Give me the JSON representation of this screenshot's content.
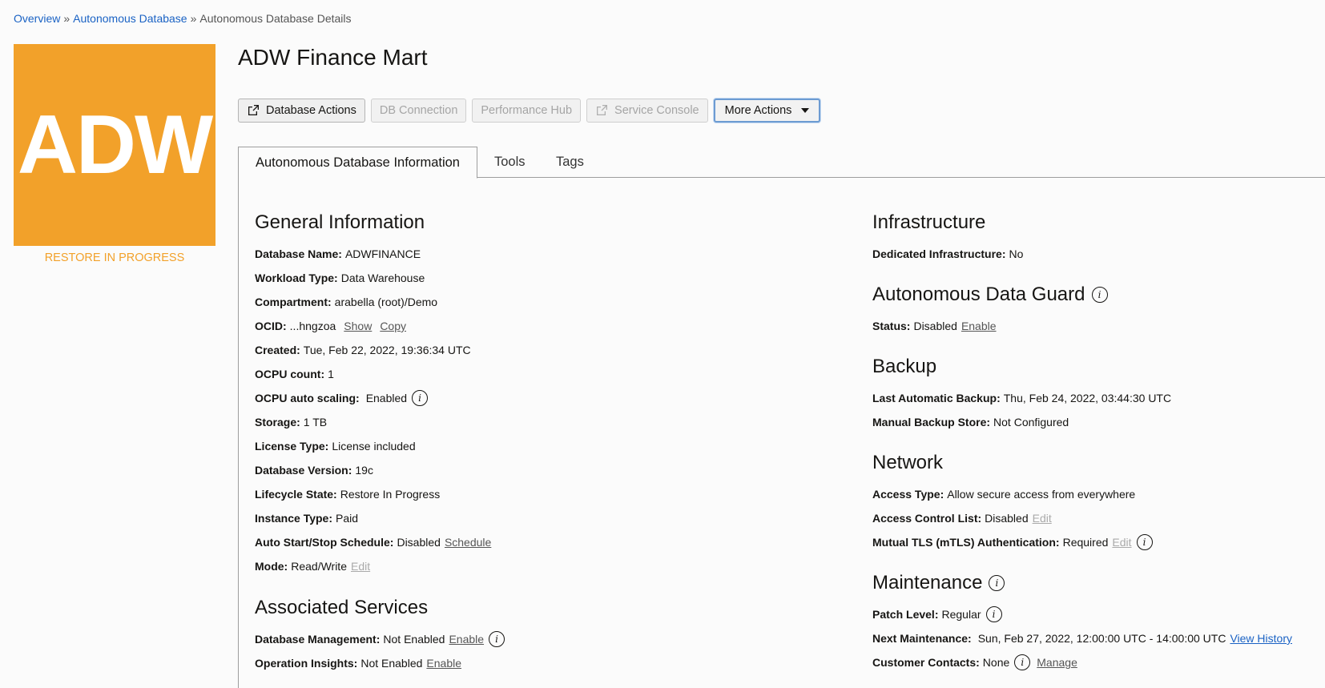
{
  "breadcrumb": {
    "items": [
      "Overview",
      "Autonomous Database"
    ],
    "current": "Autonomous Database Details",
    "separator": "»"
  },
  "logo": {
    "text": "ADW",
    "status": "RESTORE IN PROGRESS",
    "color": "#f2a12a"
  },
  "page": {
    "title": "ADW Finance Mart"
  },
  "actions": {
    "database_actions": "Database Actions",
    "db_connection": "DB Connection",
    "performance_hub": "Performance Hub",
    "service_console": "Service Console",
    "more_actions": "More Actions"
  },
  "tabs": [
    "Autonomous Database Information",
    "Tools",
    "Tags"
  ],
  "general": {
    "heading": "General Information",
    "db_name": {
      "label": "Database Name:",
      "value": "ADWFINANCE"
    },
    "workload": {
      "label": "Workload Type:",
      "value": "Data Warehouse"
    },
    "compartment": {
      "label": "Compartment:",
      "value": "arabella (root)/Demo"
    },
    "ocid": {
      "label": "OCID:",
      "value": "...hngzoa",
      "show": "Show",
      "copy": "Copy"
    },
    "created": {
      "label": "Created:",
      "value": "Tue, Feb 22, 2022, 19:36:34 UTC"
    },
    "ocpu": {
      "label": "OCPU count:",
      "value": "1"
    },
    "autoscale": {
      "label": "OCPU auto scaling:",
      "value": "Enabled"
    },
    "storage": {
      "label": "Storage:",
      "value": "1 TB"
    },
    "license": {
      "label": "License Type:",
      "value": "License included"
    },
    "version": {
      "label": "Database Version:",
      "value": "19c"
    },
    "lifecycle": {
      "label": "Lifecycle State:",
      "value": "Restore In Progress"
    },
    "instance": {
      "label": "Instance Type:",
      "value": "Paid"
    },
    "schedule": {
      "label": "Auto Start/Stop Schedule:",
      "value": "Disabled",
      "link": "Schedule"
    },
    "mode": {
      "label": "Mode:",
      "value": "Read/Write",
      "link": "Edit"
    }
  },
  "associated": {
    "heading": "Associated Services",
    "dbmgmt": {
      "label": "Database Management:",
      "value": "Not Enabled",
      "link": "Enable"
    },
    "opsi": {
      "label": "Operation Insights:",
      "value": "Not Enabled",
      "link": "Enable"
    }
  },
  "infra": {
    "heading": "Infrastructure",
    "dedicated": {
      "label": "Dedicated Infrastructure:",
      "value": "No"
    }
  },
  "dataguard": {
    "heading": "Autonomous Data Guard",
    "status": {
      "label": "Status:",
      "value": "Disabled",
      "link": "Enable"
    }
  },
  "backup": {
    "heading": "Backup",
    "last": {
      "label": "Last Automatic Backup:",
      "value": "Thu, Feb 24, 2022, 03:44:30 UTC"
    },
    "store": {
      "label": "Manual Backup Store:",
      "value": "Not Configured"
    }
  },
  "network": {
    "heading": "Network",
    "access": {
      "label": "Access Type:",
      "value": "Allow secure access from everywhere"
    },
    "acl": {
      "label": "Access Control List:",
      "value": "Disabled",
      "link": "Edit"
    },
    "mtls": {
      "label": "Mutual TLS (mTLS) Authentication:",
      "value": "Required",
      "link": "Edit"
    }
  },
  "maintenance": {
    "heading": "Maintenance",
    "patch": {
      "label": "Patch Level:",
      "value": "Regular"
    },
    "next": {
      "label": "Next Maintenance:",
      "value": "Sun, Feb 27, 2022, 12:00:00 UTC - 14:00:00 UTC",
      "link": "View History"
    },
    "contacts": {
      "label": "Customer Contacts:",
      "value": "None",
      "link": "Manage"
    }
  },
  "icons": {
    "info": "i"
  }
}
